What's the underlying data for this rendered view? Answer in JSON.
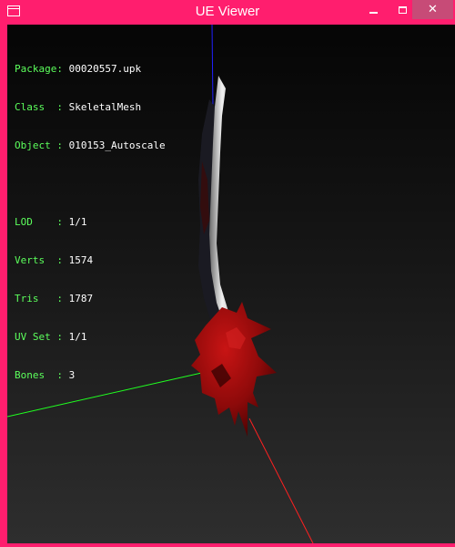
{
  "window": {
    "title": "UE Viewer",
    "app_icon": "window-app-icon",
    "controls": {
      "minimize_icon": "minimize-icon",
      "maximize_icon": "maximize-icon",
      "close_label": "✕"
    },
    "colors": {
      "frame": "#ff1e6e",
      "close_button": "#c74b77",
      "label_text": "#5cff5c",
      "value_text": "#ffffff"
    }
  },
  "info": {
    "package_label": "Package:",
    "package_value": "00020557.upk",
    "class_label": "Class  :",
    "class_value": "SkeletalMesh",
    "object_label": "Object :",
    "object_value": "010153_Autoscale",
    "lod_label": "LOD    :",
    "lod_value": "1/1",
    "verts_label": "Verts  :",
    "verts_value": "1574",
    "tris_label": "Tris   :",
    "tris_value": "1787",
    "uvset_label": "UV Set :",
    "uvset_value": "1/1",
    "bones_label": "Bones  :",
    "bones_value": "3"
  },
  "scene": {
    "axes": {
      "x_axis_color": "#ff2020",
      "y_axis_color": "#20ff20",
      "z_axis_color": "#2020ff"
    },
    "mesh": "red-spiked-sword"
  }
}
